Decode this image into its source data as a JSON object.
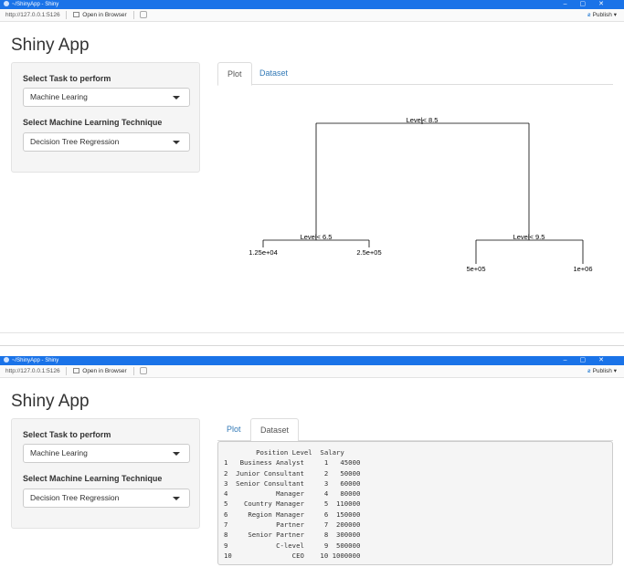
{
  "window": {
    "title": "~/ShinyApp - Shiny",
    "url": "http://127.0.0.1:5126",
    "open_in_browser": "Open in Browser",
    "publish": "Publish"
  },
  "app": {
    "title": "Shiny App",
    "task_label": "Select Task to perform",
    "task_value": "Machine Learing",
    "technique_label": "Select Machine Learning Technique",
    "technique_value": "Decision Tree Regression",
    "tabs": [
      "Plot",
      "Dataset"
    ]
  },
  "tree": {
    "root": "Level< 8.5",
    "left_split": "Level< 6.5",
    "right_split": "Level< 9.5",
    "leaves": [
      "1.25e+04",
      "2.5e+05",
      "5e+05",
      "1e+06"
    ]
  },
  "dataset": {
    "header": "        Position Level  Salary",
    "rows": [
      "1   Business Analyst     1   45000",
      "2  Junior Consultant     2   50000",
      "3  Senior Consultant     3   60000",
      "4            Manager     4   80000",
      "5    Country Manager     5  110000",
      "6     Region Manager     6  150000",
      "7            Partner     7  200000",
      "8     Senior Partner     8  300000",
      "9            C-level     9  500000",
      "10               CEO    10 1000000"
    ]
  }
}
